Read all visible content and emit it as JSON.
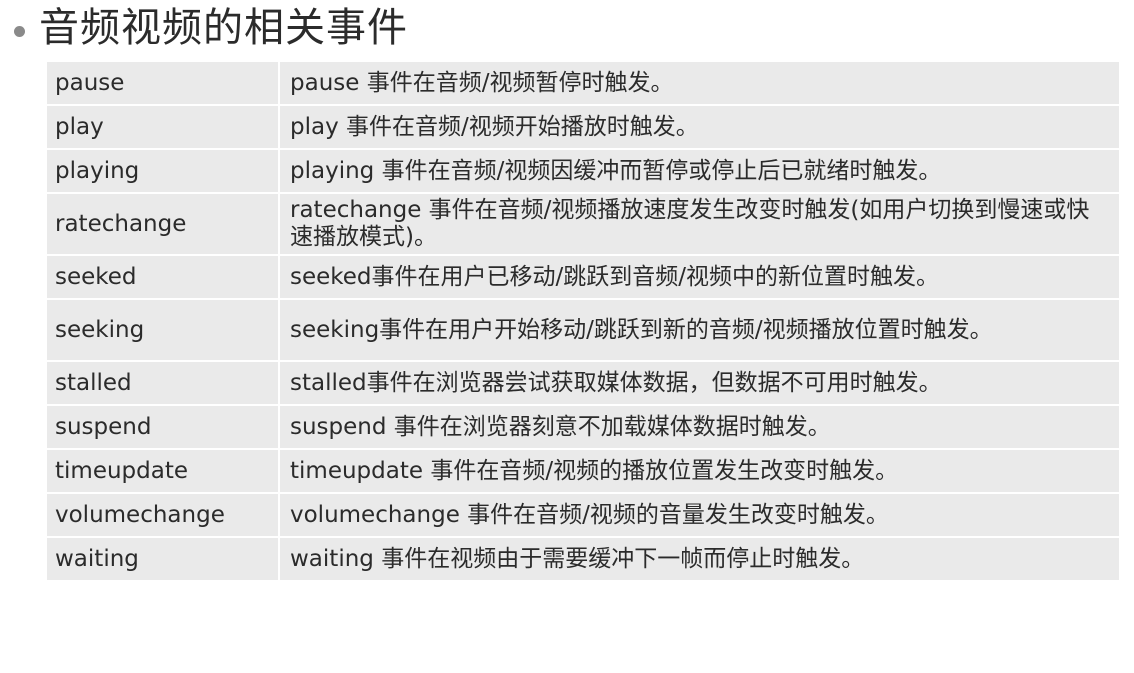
{
  "title": "音频视频的相关事件",
  "events": [
    {
      "name": "pause",
      "desc": "pause 事件在音频/视频暂停时触发。"
    },
    {
      "name": "play",
      "desc": "play 事件在音频/视频开始播放时触发。"
    },
    {
      "name": "playing",
      "desc": "playing 事件在音频/视频因缓冲而暂停或停止后已就绪时触发。"
    },
    {
      "name": "ratechange",
      "desc": "ratechange 事件在音频/视频播放速度发生改变时触发(如用户切换到慢速或快速播放模式)。"
    },
    {
      "name": "seeked",
      "desc": "seeked事件在用户已移动/跳跃到音频/视频中的新位置时触发。"
    },
    {
      "name": "seeking",
      "desc": "seeking事件在用户开始移动/跳跃到新的音频/视频播放位置时触发。"
    },
    {
      "name": "stalled",
      "desc": "stalled事件在浏览器尝试获取媒体数据，但数据不可用时触发。"
    },
    {
      "name": "suspend",
      "desc": "suspend 事件在浏览器刻意不加载媒体数据时触发。"
    },
    {
      "name": "timeupdate",
      "desc": "timeupdate 事件在音频/视频的播放位置发生改变时触发。"
    },
    {
      "name": "volumechange",
      "desc": "volumechange 事件在音频/视频的音量发生改变时触发。"
    },
    {
      "name": "waiting",
      "desc": "waiting 事件在视频由于需要缓冲下一帧而停止时触发。"
    }
  ]
}
